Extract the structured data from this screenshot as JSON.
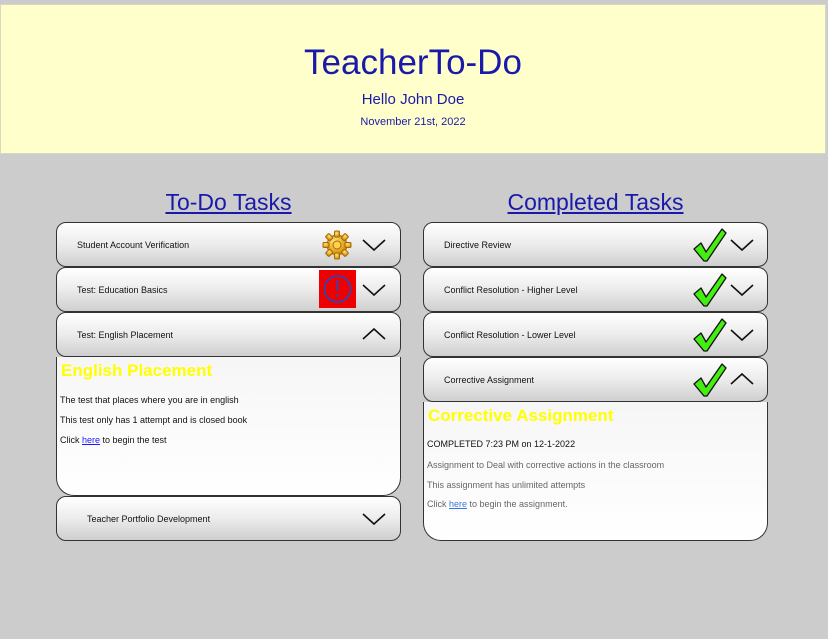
{
  "header": {
    "title": "TeacherTo-Do",
    "greeting": "Hello John Doe",
    "date": "November 21st, 2022"
  },
  "todo": {
    "heading": "To-Do Tasks",
    "items": [
      {
        "label": "Student Account Verification",
        "status_icon": "gear-icon"
      },
      {
        "label": "Test: Education Basics",
        "status_icon": "alert-icon"
      },
      {
        "label": "Test: English Placement",
        "expanded": true
      },
      {
        "label": "Teacher Portfolio Development"
      }
    ],
    "panel": {
      "title": "English Placement",
      "line1": "The test that places where you are in english",
      "line2": "This test only has 1 attempt and is closed book",
      "click_prefix": "Click ",
      "link": "here",
      "click_suffix": " to begin the test"
    }
  },
  "completed": {
    "heading": "Completed Tasks",
    "items": [
      {
        "label": "Directive Review",
        "status_icon": "checkmark-icon"
      },
      {
        "label": "Conflict Resolution - Higher Level",
        "status_icon": "checkmark-icon"
      },
      {
        "label": "Conflict Resolution - Lower Level",
        "status_icon": "checkmark-icon"
      },
      {
        "label": "Corrective Assignment",
        "status_icon": "checkmark-icon",
        "expanded": true
      }
    ],
    "panel": {
      "title": "Corrective Assignment",
      "status": "COMPLETED 7:23 PM on 12-1-2022",
      "line1": "Assignment to Deal with corrective actions in the classroom",
      "line2": "This assignment has unlimited attempts",
      "click_prefix": "Click ",
      "link": "here",
      "click_suffix": " to begin the assignment."
    }
  },
  "colors": {
    "header_bg": "#ffffcc",
    "page_bg": "#cccccc",
    "title_blue": "#1a1aaa",
    "panel_title_yellow": "#ffff00",
    "check_green": "#44ee11",
    "alert_red": "#ee0000"
  }
}
